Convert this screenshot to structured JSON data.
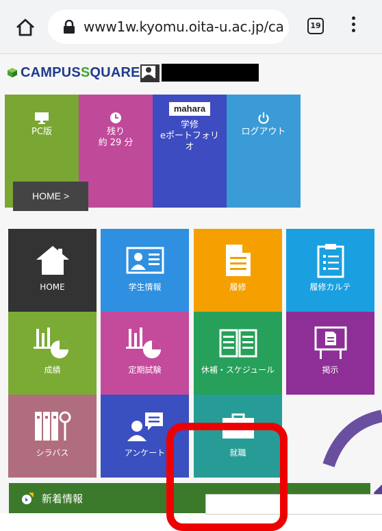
{
  "browser": {
    "url": "www1w.kyomu.oita-u.ac.jp/ca",
    "tab_count": "19"
  },
  "header": {
    "brand_prefix": "CAMPUS",
    "brand_s": "S",
    "brand_suffix": "QUARE"
  },
  "quick_tiles": [
    {
      "label": "PC版",
      "color": "#7aa634"
    },
    {
      "label": "残り",
      "sub": "約 29 分",
      "color": "#c04a9a"
    },
    {
      "logo": "mahara",
      "label": "学修",
      "sub": "eポートフォリオ",
      "color": "#3d4cc0"
    },
    {
      "label": "ログアウト",
      "color": "#3a9bd6"
    }
  ],
  "breadcrumb": "HOME >",
  "tiles": [
    {
      "label": "HOME",
      "color": "#333333"
    },
    {
      "label": "学生情報",
      "color": "#2f8fe0"
    },
    {
      "label": "履修",
      "color": "#f5a000"
    },
    {
      "label": "履修カルテ",
      "color": "#1aa0e0"
    },
    {
      "label": "成績",
      "color": "#7bab35"
    },
    {
      "label": "定期試験",
      "color": "#c44b9c"
    },
    {
      "label": "休補・スケジュール",
      "color": "#26a05a"
    },
    {
      "label": "掲示",
      "color": "#8d2f96"
    },
    {
      "label": "シラバス",
      "color": "#b06d7e"
    },
    {
      "label": "アンケート",
      "color": "#3a4fc0"
    },
    {
      "label": "就職",
      "color": "#279c96"
    }
  ],
  "news": {
    "title": "新着情報"
  }
}
